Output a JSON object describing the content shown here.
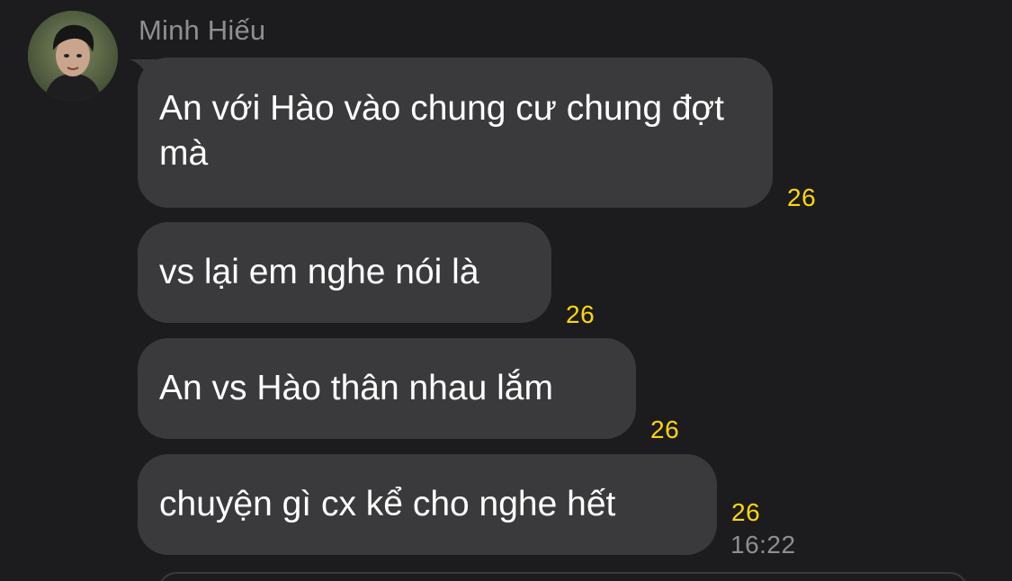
{
  "conversation": {
    "sender_name": "Minh Hiếu",
    "messages": [
      {
        "text": "An với Hào vào chung cư chung đợt mà",
        "reaction": "26"
      },
      {
        "text": "vs lại em nghe nói là",
        "reaction": "26"
      },
      {
        "text": "An vs Hào thân nhau lắm",
        "reaction": "26"
      },
      {
        "text": "chuyện gì cx kể cho nghe hết",
        "reaction": "26"
      }
    ],
    "last_timestamp": "16:22"
  },
  "colors": {
    "background": "#1c1c1e",
    "bubble": "#3a3a3c",
    "reaction": "#ffd60a",
    "muted_text": "#8e8e93"
  },
  "icons": {
    "avatar": "user-avatar-photo"
  }
}
